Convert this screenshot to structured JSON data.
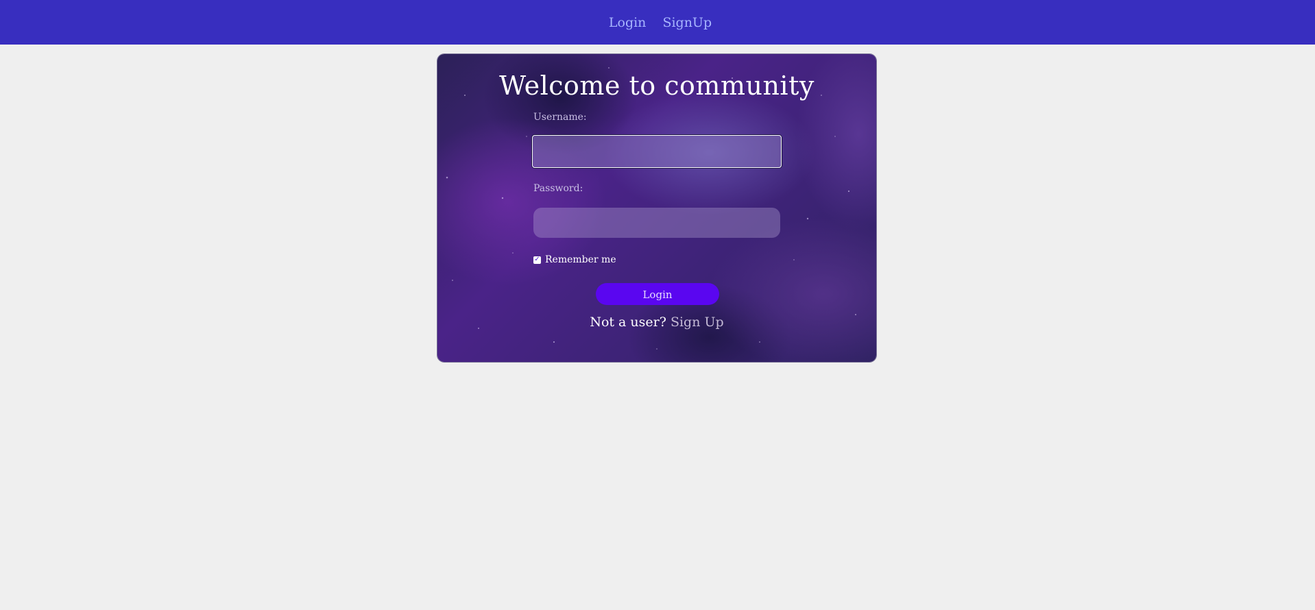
{
  "nav": {
    "items": [
      {
        "label": "Login"
      },
      {
        "label": "SignUp"
      }
    ]
  },
  "card": {
    "title": "Welcome to community",
    "username": {
      "label": "Username:",
      "value": ""
    },
    "password": {
      "label": "Password:",
      "value": ""
    },
    "remember": {
      "label": "Remember me",
      "checked": true
    },
    "login_button": "Login",
    "signup_prompt": "Not a user?",
    "signup_link": "Sign Up"
  },
  "colors": {
    "nav_bg": "#382ebf",
    "nav_link": "#a8b6ff",
    "page_bg": "#efefef",
    "button_bg": "#5a06f0",
    "card_bg": "#3f2379"
  }
}
